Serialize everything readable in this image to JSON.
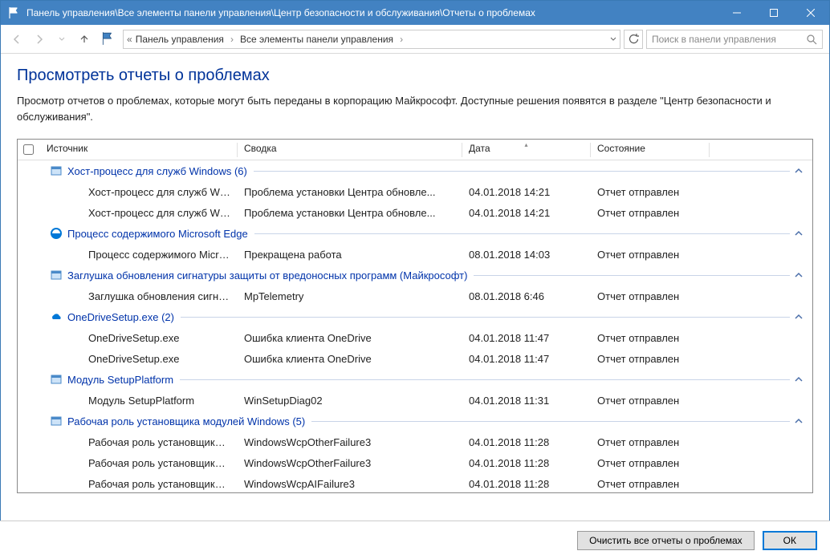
{
  "titlebar": {
    "title": "Панель управления\\Все элементы панели управления\\Центр безопасности и обслуживания\\Отчеты о проблемах"
  },
  "breadcrumb": {
    "part1": "Панель управления",
    "part2": "Все элементы панели управления"
  },
  "search": {
    "placeholder": "Поиск в панели управления"
  },
  "page": {
    "title": "Просмотреть отчеты о проблемах",
    "description": "Просмотр отчетов о проблемах, которые могут быть переданы в корпорацию Майкрософт. Доступные решения появятся в разделе \"Центр безопасности и обслуживания\"."
  },
  "columns": {
    "source": "Источник",
    "summary": "Сводка",
    "date": "Дата",
    "status": "Состояние"
  },
  "groups": [
    {
      "name": "Хост-процесс для служб Windows (6)",
      "icon": "window",
      "rows": [
        {
          "source": "Хост-процесс для служб Win...",
          "summary": "Проблема установки Центра обновле...",
          "date": "04.01.2018 14:21",
          "status": "Отчет отправлен"
        },
        {
          "source": "Хост-процесс для служб Win...",
          "summary": "Проблема установки Центра обновле...",
          "date": "04.01.2018 14:21",
          "status": "Отчет отправлен"
        }
      ]
    },
    {
      "name": "Процесс содержимого Microsoft Edge",
      "icon": "edge",
      "rows": [
        {
          "source": "Процесс содержимого Micro...",
          "summary": "Прекращена работа",
          "date": "08.01.2018 14:03",
          "status": "Отчет отправлен"
        }
      ]
    },
    {
      "name": "Заглушка обновления сигнатуры защиты от вредоносных программ (Майкрософт)",
      "icon": "window",
      "rows": [
        {
          "source": "Заглушка обновления сигнат...",
          "summary": "MpTelemetry",
          "date": "08.01.2018 6:46",
          "status": "Отчет отправлен"
        }
      ]
    },
    {
      "name": "OneDriveSetup.exe (2)",
      "icon": "onedrive",
      "rows": [
        {
          "source": "OneDriveSetup.exe",
          "summary": "Ошибка клиента OneDrive",
          "date": "04.01.2018 11:47",
          "status": "Отчет отправлен"
        },
        {
          "source": "OneDriveSetup.exe",
          "summary": "Ошибка клиента OneDrive",
          "date": "04.01.2018 11:47",
          "status": "Отчет отправлен"
        }
      ]
    },
    {
      "name": "Модуль SetupPlatform",
      "icon": "window",
      "rows": [
        {
          "source": "Модуль SetupPlatform",
          "summary": "WinSetupDiag02",
          "date": "04.01.2018 11:31",
          "status": "Отчет отправлен"
        }
      ]
    },
    {
      "name": "Рабочая роль установщика модулей Windows (5)",
      "icon": "window",
      "rows": [
        {
          "source": "Рабочая роль установщика м...",
          "summary": "WindowsWcpOtherFailure3",
          "date": "04.01.2018 11:28",
          "status": "Отчет отправлен"
        },
        {
          "source": "Рабочая роль установщика м...",
          "summary": "WindowsWcpOtherFailure3",
          "date": "04.01.2018 11:28",
          "status": "Отчет отправлен"
        },
        {
          "source": "Рабочая роль установщика м...",
          "summary": "WindowsWcpAIFailure3",
          "date": "04.01.2018 11:28",
          "status": "Отчет отправлен"
        }
      ]
    }
  ],
  "footer": {
    "clear": "Очистить все отчеты о проблемах",
    "ok": "ОК"
  }
}
